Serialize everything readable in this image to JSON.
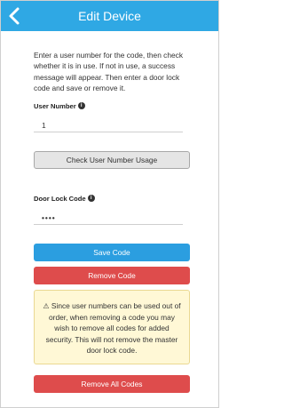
{
  "header": {
    "title": "Edit Device",
    "back_icon": "chevron-left-icon"
  },
  "intro": "Enter a user number for the code, then check whether it is in use. If not in use, a success message will appear. Then enter a door lock code and save or remove it.",
  "user_number": {
    "label": "User Number",
    "info_icon": "info-icon",
    "value": "1"
  },
  "check_button": "Check User Number Usage",
  "door_lock_code": {
    "label": "Door Lock Code",
    "info_icon": "info-icon",
    "value": "••••"
  },
  "save_button": "Save Code",
  "remove_button": "Remove Code",
  "warning": {
    "icon": "warning-icon",
    "text": "Since user numbers can be used out of order, when removing a code you may wish to remove all codes for added security. This will not remove the master door lock code."
  },
  "remove_all_button": "Remove All Codes",
  "colors": {
    "header": "#2fa8e4",
    "save": "#2b9ee0",
    "remove": "#de4c4c",
    "warning_bg": "#fff8d6"
  }
}
